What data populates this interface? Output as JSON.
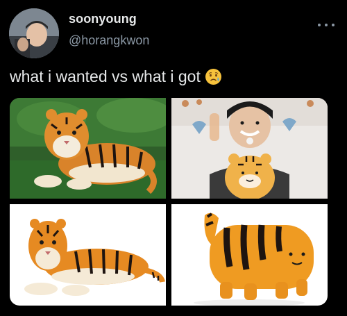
{
  "user": {
    "display_name": "soonyoung",
    "handle": "@horangkwon"
  },
  "tweet": {
    "text": "what i wanted vs what i got",
    "emoji_icon": "sad-relieved-face-icon"
  },
  "media": [
    {
      "name": "photo-realistic-tiger"
    },
    {
      "name": "photo-man-with-tiger-plush"
    },
    {
      "name": "photo-tiger-plush-toy"
    },
    {
      "name": "photo-orange-striped-plush"
    }
  ],
  "colors": {
    "background": "#000000",
    "text": "#e7e9ea",
    "secondary_text": "#8b98a5"
  }
}
